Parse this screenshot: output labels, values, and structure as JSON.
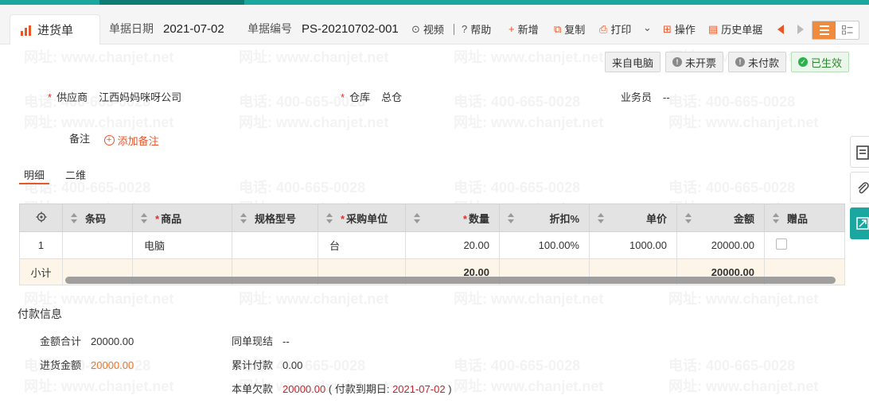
{
  "header": {
    "tab_title": "进货单",
    "date_label": "单据日期",
    "date_value": "2021-07-02",
    "no_label": "单据编号",
    "no_value": "PS-20210702-001",
    "toolbar": {
      "video": "视频",
      "help": "帮助",
      "add": "新增",
      "copy": "复制",
      "print": "打印",
      "operate": "操作",
      "history": "历史单据"
    }
  },
  "badges": {
    "source": "来自电脑",
    "invoice": "未开票",
    "payment": "未付款",
    "status": "已生效"
  },
  "form": {
    "supplier_label": "供应商",
    "supplier_value": "江西妈妈咪呀公司",
    "warehouse_label": "仓库",
    "warehouse_value": "总仓",
    "salesman_label": "业务员",
    "salesman_value": "--",
    "note_label": "备注",
    "add_note": "添加备注"
  },
  "subtabs": [
    "明细",
    "二维"
  ],
  "grid": {
    "headers": [
      "条码",
      "商品",
      "规格型号",
      "采购单位",
      "数量",
      "折扣%",
      "单价",
      "金额",
      "赠品"
    ],
    "rows": [
      {
        "index": "1",
        "barcode": "",
        "product": "电脑",
        "spec": "",
        "unit": "台",
        "qty": "20.00",
        "discount": "100.00%",
        "price": "1000.00",
        "amount": "20000.00"
      }
    ],
    "subtotal": {
      "label": "小计",
      "qty": "20.00",
      "amount": "20000.00"
    }
  },
  "payment": {
    "title": "付款信息",
    "total_label": "金额合计",
    "total_value": "20000.00",
    "purchase_label": "进货金额",
    "purchase_value": "20000.00",
    "cash_label": "同单现结",
    "cash_value": "--",
    "paid_label": "累计付款",
    "paid_value": "0.00",
    "due_label": "本单欠款",
    "due_value": "20000.00",
    "due_date_prefix": "( 付款到期日:",
    "due_date": "2021-07-02",
    "due_date_suffix": ")"
  },
  "watermark": {
    "phone": "电话: 400-665-0028",
    "site": "网址: www.chanjet.net"
  },
  "colors": {
    "accent": "#e8572a",
    "teal": "#1aa7a0",
    "ok": "#2bb24c"
  }
}
